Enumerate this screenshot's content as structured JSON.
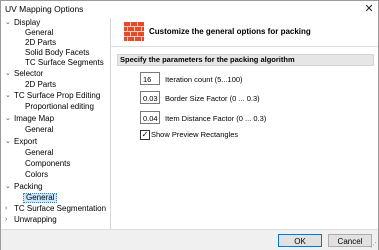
{
  "window": {
    "title": "UV Mapping Options",
    "close_glyph": "✕"
  },
  "tree": {
    "items": [
      {
        "label": "Display",
        "expanded": true,
        "level": 0
      },
      {
        "label": "General",
        "level": 1
      },
      {
        "label": "2D Parts",
        "level": 1
      },
      {
        "label": "Solid Body Facets",
        "level": 1
      },
      {
        "label": "TC Surface Segments",
        "level": 1
      },
      {
        "label": "Selector",
        "expanded": true,
        "level": 0
      },
      {
        "label": "2D Parts",
        "level": 1
      },
      {
        "label": "TC Surface Prop Editing",
        "expanded": true,
        "level": 0
      },
      {
        "label": "Proportional editing",
        "level": 1
      },
      {
        "label": "Image Map",
        "expanded": true,
        "level": 0
      },
      {
        "label": "General",
        "level": 1
      },
      {
        "label": "Export",
        "expanded": true,
        "level": 0
      },
      {
        "label": "General",
        "level": 1
      },
      {
        "label": "Components",
        "level": 1
      },
      {
        "label": "Colors",
        "level": 1
      },
      {
        "label": "Packing",
        "expanded": true,
        "level": 0
      },
      {
        "label": "General",
        "level": 1,
        "selected": true
      },
      {
        "label": "TC Surface Segmentation",
        "expanded": false,
        "level": 0
      },
      {
        "label": "Unwrapping",
        "expanded": false,
        "level": 0
      }
    ]
  },
  "header": {
    "text": "Customize the general options for packing",
    "icon": "brick-wall-icon"
  },
  "section": {
    "title": "Specify the parameters for the packing algorithm"
  },
  "fields": [
    {
      "value": "16",
      "label": "Iteration count (5...100)"
    },
    {
      "value": "0.03",
      "label": "Border Size Factor (0 ... 0.3)"
    },
    {
      "value": "0.04",
      "label": "Item Distance Factor (0 ... 0.3)"
    }
  ],
  "checkbox": {
    "label": "Show Preview Rectangles",
    "checked": true,
    "check_glyph": "✓"
  },
  "buttons": {
    "ok": "OK",
    "cancel": "Cancel"
  },
  "colors": {
    "selection": "#cce8ff",
    "section_bar": "#e6e6e6",
    "brick": "#e24b2c"
  }
}
